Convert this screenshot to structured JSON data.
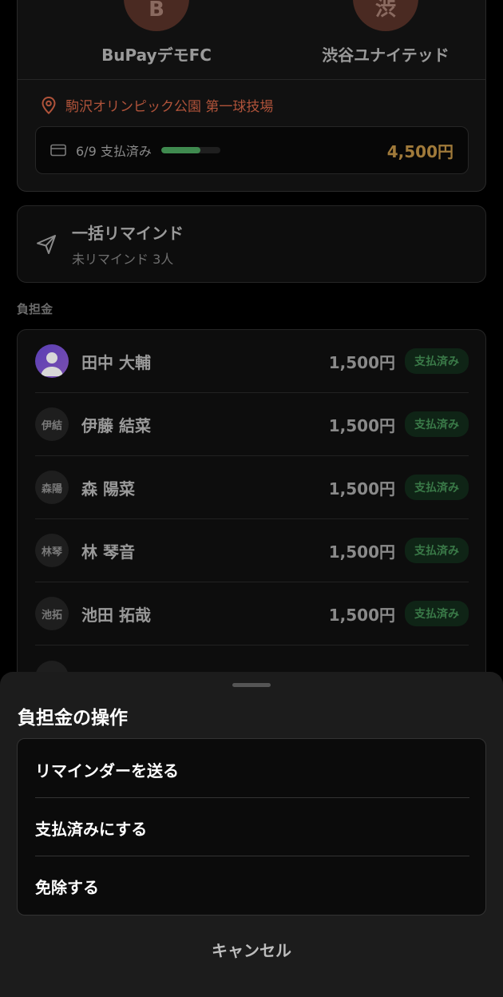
{
  "match": {
    "home_team": "BuPayデモFC",
    "home_logo_letter": "B",
    "away_team": "渋谷ユナイテッド",
    "away_logo_letter": "渋",
    "venue": "駒沢オリンピック公園 第一球技場",
    "payment_status": "6/9 支払済み",
    "payment_progress": 0.667,
    "total_amount": "4,500円"
  },
  "reminder": {
    "title": "一括リマインド",
    "subtitle": "未リマインド 3人"
  },
  "fees_section": {
    "label": "負担金",
    "members": [
      {
        "avatar": "",
        "name": "田中 大輔",
        "amount": "1,500円",
        "status": "支払済み"
      },
      {
        "avatar": "伊結",
        "name": "伊藤 結菜",
        "amount": "1,500円",
        "status": "支払済み"
      },
      {
        "avatar": "森陽",
        "name": "森 陽菜",
        "amount": "1,500円",
        "status": "支払済み"
      },
      {
        "avatar": "林琴",
        "name": "林 琴音",
        "amount": "1,500円",
        "status": "支払済み"
      },
      {
        "avatar": "池拓",
        "name": "池田 拓哉",
        "amount": "1,500円",
        "status": "支払済み"
      },
      {
        "avatar": "",
        "name": "",
        "amount": "",
        "status": ""
      }
    ]
  },
  "sheet": {
    "title": "負担金の操作",
    "actions": [
      "リマインダーを送る",
      "支払済みにする",
      "免除する"
    ],
    "cancel": "キャンセル"
  },
  "colors": {
    "accent_orange": "#b0533a",
    "paid_green": "#3a7a48",
    "amount_gold": "#a07a3a"
  }
}
